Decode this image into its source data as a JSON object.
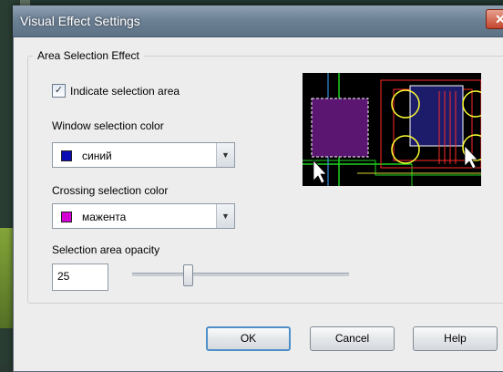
{
  "window": {
    "title": "Visual Effect Settings",
    "close_glyph": "✕"
  },
  "group": {
    "label": "Area Selection Effect"
  },
  "indicate_selection": {
    "label": "Indicate selection area",
    "checked": true
  },
  "window_color": {
    "label": "Window selection color",
    "value": "синий",
    "swatch_color": "#0a0ab4"
  },
  "crossing_color": {
    "label": "Crossing selection color",
    "value": "мажента",
    "swatch_color": "#d400d4"
  },
  "opacity": {
    "label": "Selection area opacity",
    "value": "25",
    "level": 25
  },
  "buttons": {
    "ok": "OK",
    "cancel": "Cancel",
    "help": "Help"
  },
  "icons": {
    "dropdown": "chevron-down-icon",
    "check": "check-icon"
  }
}
